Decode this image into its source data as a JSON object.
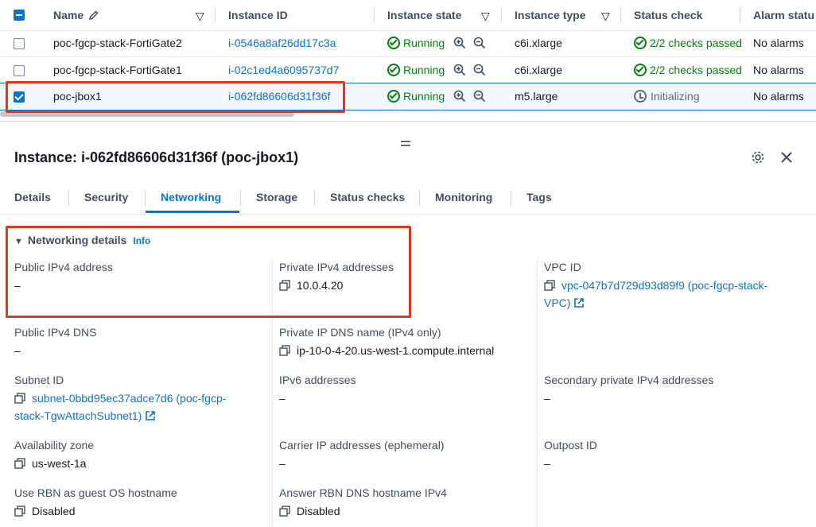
{
  "table": {
    "columns": {
      "name": "Name",
      "instance_id": "Instance ID",
      "instance_state": "Instance state",
      "instance_type": "Instance type",
      "status_check": "Status check",
      "alarm_status": "Alarm statu"
    },
    "rows": [
      {
        "name": "poc-fgcp-stack-FortiGate2",
        "instance_id": "i-0546a8af26dd17c3a",
        "state": "Running",
        "type": "c6i.xlarge",
        "status": "2/2 checks passed",
        "alarm": "No alarms"
      },
      {
        "name": "poc-fgcp-stack-FortiGate1",
        "instance_id": "i-02c1ed4a6095737d7",
        "state": "Running",
        "type": "c6i.xlarge",
        "status": "2/2 checks passed",
        "alarm": "No alarms"
      },
      {
        "name": "poc-jbox1",
        "instance_id": "i-062fd86606d31f36f",
        "state": "Running",
        "type": "m5.large",
        "status": "Initializing",
        "alarm": "No alarms"
      }
    ]
  },
  "panel": {
    "title": "Instance: i-062fd86606d31f36f (poc-jbox1)",
    "tabs": [
      "Details",
      "Security",
      "Networking",
      "Storage",
      "Status checks",
      "Monitoring",
      "Tags"
    ],
    "section": {
      "title": "Networking details",
      "info": "Info"
    },
    "fields": {
      "public_ipv4": {
        "label": "Public IPv4 address",
        "value": "–"
      },
      "private_ipv4": {
        "label": "Private IPv4 addresses",
        "value": "10.0.4.20"
      },
      "vpc_id": {
        "label": "VPC ID",
        "value_line1": "vpc-047b7d729d93d89f9 (poc-fgcp-stack-",
        "value_line2": "VPC)"
      },
      "public_dns": {
        "label": "Public IPv4 DNS",
        "value": "–"
      },
      "private_dns": {
        "label": "Private IP DNS name (IPv4 only)",
        "value": "ip-10-0-4-20.us-west-1.compute.internal"
      },
      "subnet_id": {
        "label": "Subnet ID",
        "value_line1": "subnet-0bbd95ec37adce7d6 (poc-fgcp-",
        "value_line2": "stack-TgwAttachSubnet1)"
      },
      "ipv6": {
        "label": "IPv6 addresses",
        "value": "–"
      },
      "secondary_ipv4": {
        "label": "Secondary private IPv4 addresses",
        "value": "–"
      },
      "az": {
        "label": "Availability zone",
        "value": "us-west-1a"
      },
      "carrier_ip": {
        "label": "Carrier IP addresses (ephemeral)",
        "value": "–"
      },
      "outpost": {
        "label": "Outpost ID",
        "value": "–"
      },
      "rbn_hostname": {
        "label": "Use RBN as guest OS hostname",
        "value": "Disabled"
      },
      "rbn_dns": {
        "label": "Answer RBN DNS hostname IPv4",
        "value": "Disabled"
      }
    }
  },
  "colors": {
    "link": "#0972d3",
    "success": "#037f0c",
    "highlight": "#e8331f"
  },
  "icons": [
    "edit-icon",
    "sort-icon",
    "zoom-in-icon",
    "zoom-out-icon",
    "check-circle-icon",
    "clock-icon",
    "gear-icon",
    "close-icon",
    "copy-icon",
    "external-link-icon",
    "caret-down-icon"
  ]
}
